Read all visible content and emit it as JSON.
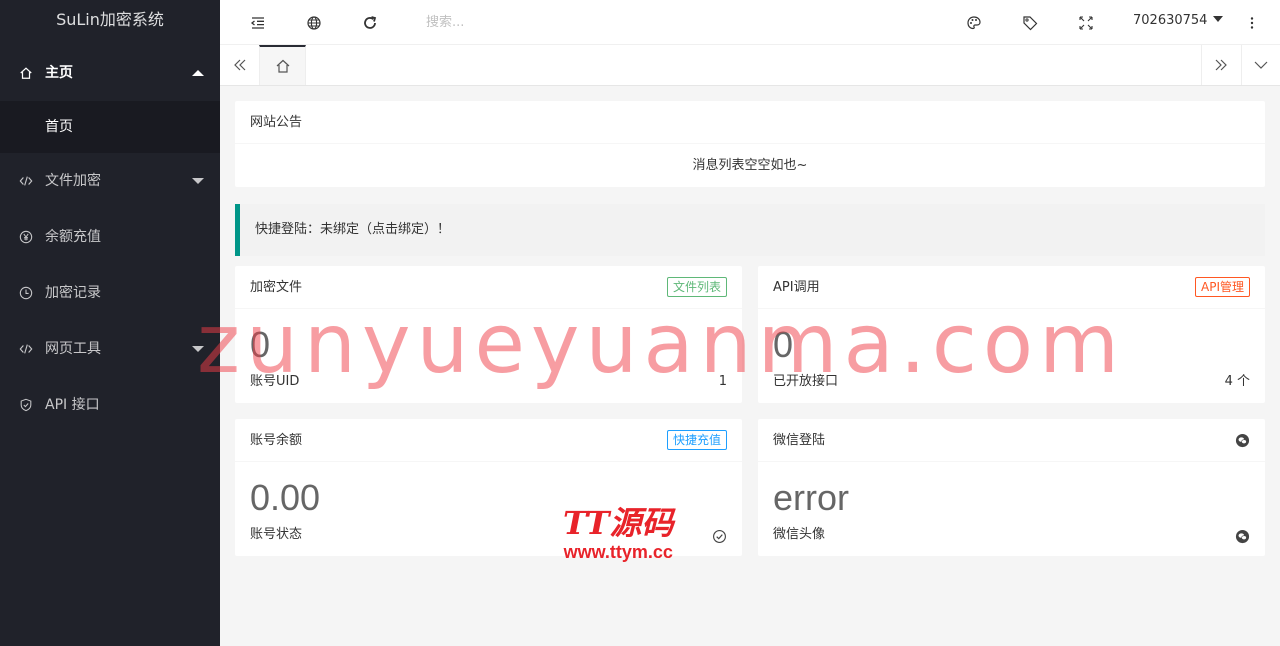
{
  "app": {
    "title": "SuLin加密系统"
  },
  "sidebar": {
    "items": [
      {
        "label": "主页",
        "icon": "home-icon"
      },
      {
        "label": "首页"
      },
      {
        "label": "文件加密",
        "icon": "code-icon"
      },
      {
        "label": "余额充值",
        "icon": "yen-icon"
      },
      {
        "label": "加密记录",
        "icon": "clock-icon"
      },
      {
        "label": "网页工具",
        "icon": "code-icon"
      },
      {
        "label": "API 接口",
        "icon": "shield-icon"
      }
    ]
  },
  "header": {
    "search_placeholder": "搜索...",
    "username": "702630754"
  },
  "notice": {
    "title": "网站公告",
    "empty_text": "消息列表空空如也~"
  },
  "quick_login": {
    "text": "快捷登陆：未绑定（点击绑定）！"
  },
  "cards": {
    "files": {
      "title": "加密文件",
      "badge": "文件列表",
      "value": "0",
      "foot_label": "账号UID",
      "foot_value": "1"
    },
    "api": {
      "title": "API调用",
      "badge": "API管理",
      "value": "0",
      "foot_label": "已开放接口",
      "foot_value": "4 个"
    },
    "balance": {
      "title": "账号余额",
      "badge": "快捷充值",
      "value": "0.00",
      "foot_label": "账号状态"
    },
    "wechat": {
      "title": "微信登陆",
      "value": "error",
      "foot_label": "微信头像"
    }
  },
  "watermarks": {
    "main": "zunyueyuanma.com",
    "brand_line1": "TT源码",
    "brand_line2": "www.ttym.cc"
  },
  "colors": {
    "sidebar_bg": "#20222a",
    "accent_green": "#009688",
    "badge_green": "#5FB878",
    "badge_red": "#FF5722",
    "badge_blue": "#1E9FFF"
  }
}
